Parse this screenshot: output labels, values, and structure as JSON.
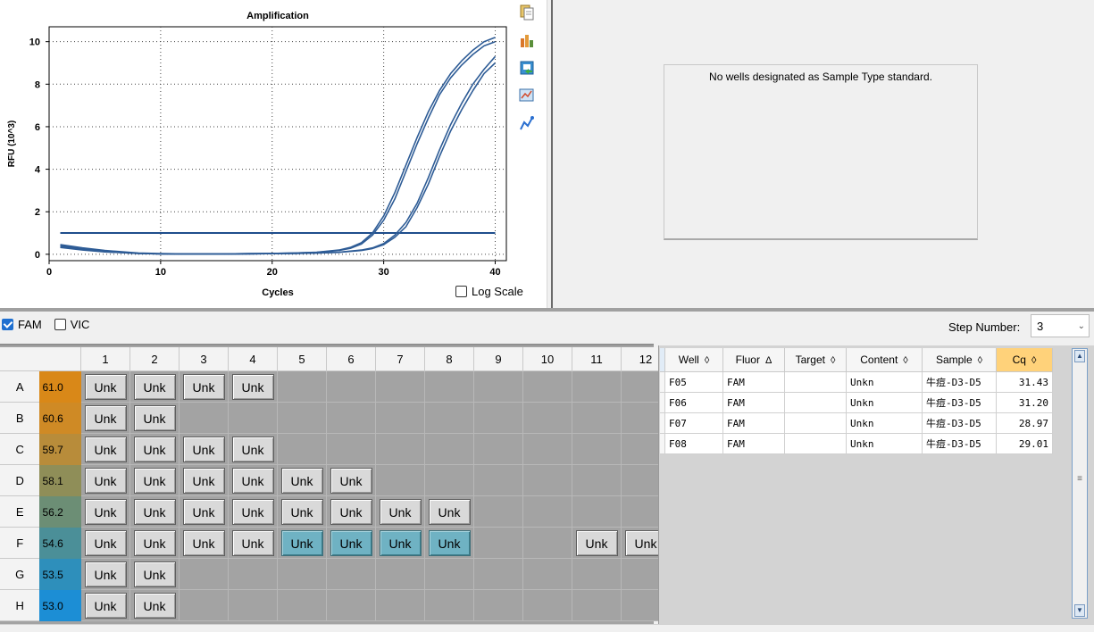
{
  "chart_data": {
    "type": "line",
    "title": "Amplification",
    "xlabel": "Cycles",
    "ylabel": "RFU (10^3)",
    "xlim": [
      0,
      41
    ],
    "ylim": [
      -0.3,
      10.7
    ],
    "xticks": [
      0,
      10,
      20,
      30,
      40
    ],
    "yticks": [
      0,
      2,
      4,
      6,
      8,
      10
    ],
    "grid": true,
    "threshold": 1.0,
    "series": [
      {
        "x": [
          1,
          3,
          5,
          8,
          10,
          12,
          14,
          16,
          18,
          20,
          22,
          24,
          26,
          27,
          28,
          29,
          30,
          31,
          32,
          33,
          34,
          35,
          36,
          37,
          38,
          39,
          40
        ],
        "values": [
          0.45,
          0.3,
          0.18,
          0.06,
          0.03,
          0.02,
          0.02,
          0.02,
          0.03,
          0.04,
          0.06,
          0.1,
          0.2,
          0.32,
          0.55,
          1.0,
          1.8,
          2.9,
          4.2,
          5.5,
          6.7,
          7.7,
          8.5,
          9.1,
          9.6,
          10.0,
          10.2
        ]
      },
      {
        "x": [
          1,
          3,
          5,
          8,
          10,
          12,
          14,
          16,
          18,
          20,
          22,
          24,
          26,
          27,
          28,
          29,
          30,
          31,
          32,
          33,
          34,
          35,
          36,
          37,
          38,
          39,
          40
        ],
        "values": [
          0.4,
          0.26,
          0.15,
          0.05,
          0.02,
          0.01,
          0.01,
          0.02,
          0.03,
          0.04,
          0.06,
          0.09,
          0.18,
          0.28,
          0.48,
          0.9,
          1.6,
          2.6,
          3.9,
          5.2,
          6.4,
          7.5,
          8.3,
          8.9,
          9.4,
          9.8,
          10.0
        ]
      },
      {
        "x": [
          1,
          3,
          5,
          8,
          10,
          12,
          14,
          16,
          18,
          20,
          22,
          24,
          26,
          28,
          29,
          30,
          31,
          32,
          33,
          34,
          35,
          36,
          37,
          38,
          39,
          40
        ],
        "values": [
          0.35,
          0.22,
          0.12,
          0.04,
          0.02,
          0.01,
          0.01,
          0.01,
          0.02,
          0.03,
          0.04,
          0.06,
          0.1,
          0.2,
          0.3,
          0.5,
          0.9,
          1.5,
          2.4,
          3.6,
          4.9,
          6.1,
          7.1,
          8.0,
          8.7,
          9.3
        ]
      },
      {
        "x": [
          1,
          3,
          5,
          8,
          10,
          12,
          14,
          16,
          18,
          20,
          22,
          24,
          26,
          28,
          29,
          30,
          31,
          32,
          33,
          34,
          35,
          36,
          37,
          38,
          39,
          40
        ],
        "values": [
          0.32,
          0.2,
          0.11,
          0.04,
          0.02,
          0.01,
          0.01,
          0.01,
          0.02,
          0.03,
          0.04,
          0.06,
          0.09,
          0.18,
          0.27,
          0.45,
          0.8,
          1.3,
          2.2,
          3.3,
          4.6,
          5.8,
          6.8,
          7.7,
          8.5,
          9.0
        ]
      }
    ]
  },
  "log_scale_label": "Log Scale",
  "toolbar_icons": [
    "copy-icon",
    "export-icon",
    "save-chart-icon",
    "zoom-chart-icon",
    "chart-settings-icon"
  ],
  "std_message": "No wells designated as Sample Type standard.",
  "fluors": [
    {
      "label": "FAM",
      "checked": true
    },
    {
      "label": "VIC",
      "checked": false
    }
  ],
  "step_number": {
    "label": "Step Number:",
    "value": "3"
  },
  "plate": {
    "columns": [
      "1",
      "2",
      "3",
      "4",
      "5",
      "6",
      "7",
      "8",
      "9",
      "10",
      "11",
      "12"
    ],
    "rows": [
      {
        "label": "A",
        "temp": "61.0",
        "color": "#d98818"
      },
      {
        "label": "B",
        "temp": "60.6",
        "color": "#cf8a25"
      },
      {
        "label": "C",
        "temp": "59.7",
        "color": "#b88c3a"
      },
      {
        "label": "D",
        "temp": "58.1",
        "color": "#8f8e58"
      },
      {
        "label": "E",
        "temp": "56.2",
        "color": "#6c8e75"
      },
      {
        "label": "F",
        "temp": "54.6",
        "color": "#4b8f98"
      },
      {
        "label": "G",
        "temp": "53.5",
        "color": "#2e8fbb"
      },
      {
        "label": "H",
        "temp": "53.0",
        "color": "#1c8ed5"
      }
    ],
    "well_label": "Unk",
    "wells": {
      "A": [
        1,
        1,
        1,
        1,
        0,
        0,
        0,
        0,
        0,
        0,
        0,
        0
      ],
      "B": [
        1,
        1,
        0,
        0,
        0,
        0,
        0,
        0,
        0,
        0,
        0,
        0
      ],
      "C": [
        1,
        1,
        1,
        1,
        0,
        0,
        0,
        0,
        0,
        0,
        0,
        0
      ],
      "D": [
        1,
        1,
        1,
        1,
        1,
        1,
        0,
        0,
        0,
        0,
        0,
        0
      ],
      "E": [
        1,
        1,
        1,
        1,
        1,
        1,
        1,
        1,
        0,
        0,
        0,
        0
      ],
      "F": [
        1,
        1,
        1,
        1,
        2,
        2,
        2,
        2,
        0,
        0,
        1,
        1
      ],
      "G": [
        1,
        1,
        0,
        0,
        0,
        0,
        0,
        0,
        0,
        0,
        0,
        0
      ],
      "H": [
        1,
        1,
        0,
        0,
        0,
        0,
        0,
        0,
        0,
        0,
        0,
        0
      ]
    }
  },
  "results": {
    "headers": [
      {
        "label": "Well",
        "sort": "◊"
      },
      {
        "label": "Fluor",
        "sort": "Δ"
      },
      {
        "label": "Target",
        "sort": "◊"
      },
      {
        "label": "Content",
        "sort": "◊"
      },
      {
        "label": "Sample",
        "sort": "◊"
      },
      {
        "label": "Cq",
        "sort": "◊"
      }
    ],
    "rows": [
      [
        "F05",
        "FAM",
        "",
        "Unkn",
        "牛痘-D3-D5",
        "31.43"
      ],
      [
        "F06",
        "FAM",
        "",
        "Unkn",
        "牛痘-D3-D5",
        "31.20"
      ],
      [
        "F07",
        "FAM",
        "",
        "Unkn",
        "牛痘-D3-D5",
        "28.97"
      ],
      [
        "F08",
        "FAM",
        "",
        "Unkn",
        "牛痘-D3-D5",
        "29.01"
      ]
    ]
  }
}
